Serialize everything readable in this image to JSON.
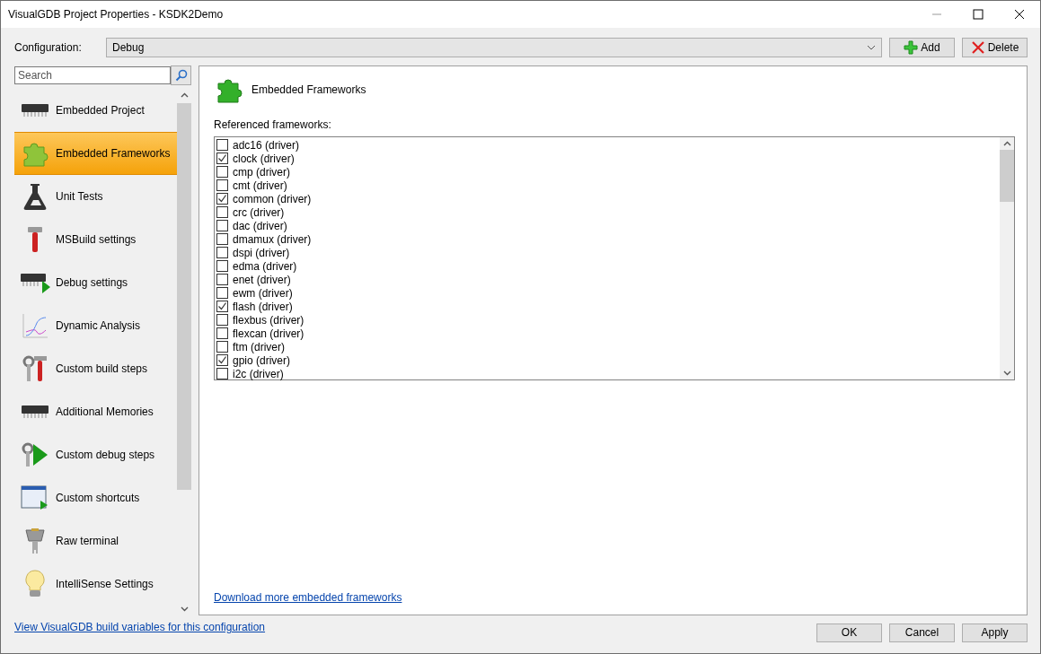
{
  "window": {
    "title": "VisualGDB Project Properties - KSDK2Demo"
  },
  "configuration": {
    "label": "Configuration:",
    "value": "Debug",
    "buttons": [
      {
        "kind": "add",
        "label": "Add"
      },
      {
        "kind": "delete",
        "label": "Delete"
      }
    ]
  },
  "search": {
    "placeholder": "Search"
  },
  "sidebar": {
    "items": [
      {
        "kind": "chip",
        "label": "Embedded Project",
        "selected": false
      },
      {
        "kind": "puzzle",
        "label": "Embedded Frameworks",
        "selected": true
      },
      {
        "kind": "flask",
        "label": "Unit Tests",
        "selected": false
      },
      {
        "kind": "hammer",
        "label": "MSBuild settings",
        "selected": false
      },
      {
        "kind": "chip-play",
        "label": "Debug settings",
        "selected": false
      },
      {
        "kind": "graph",
        "label": "Dynamic Analysis",
        "selected": false
      },
      {
        "kind": "tools",
        "label": "Custom build steps",
        "selected": false
      },
      {
        "kind": "chip",
        "label": "Additional Memories",
        "selected": false
      },
      {
        "kind": "wrench-play",
        "label": "Custom debug steps",
        "selected": false
      },
      {
        "kind": "window-play",
        "label": "Custom shortcuts",
        "selected": false
      },
      {
        "kind": "connector",
        "label": "Raw terminal",
        "selected": false
      },
      {
        "kind": "bulb",
        "label": "IntelliSense Settings",
        "selected": false
      }
    ]
  },
  "page": {
    "title": "Embedded Frameworks",
    "list_label": "Referenced frameworks:",
    "frameworks": [
      {
        "label": "adc16 (driver)",
        "checked": false
      },
      {
        "label": "clock (driver)",
        "checked": true
      },
      {
        "label": "cmp (driver)",
        "checked": false
      },
      {
        "label": "cmt (driver)",
        "checked": false
      },
      {
        "label": "common (driver)",
        "checked": true
      },
      {
        "label": "crc (driver)",
        "checked": false
      },
      {
        "label": "dac (driver)",
        "checked": false
      },
      {
        "label": "dmamux (driver)",
        "checked": false
      },
      {
        "label": "dspi (driver)",
        "checked": false
      },
      {
        "label": "edma (driver)",
        "checked": false
      },
      {
        "label": "enet (driver)",
        "checked": false
      },
      {
        "label": "ewm (driver)",
        "checked": false
      },
      {
        "label": "flash (driver)",
        "checked": true
      },
      {
        "label": "flexbus (driver)",
        "checked": false
      },
      {
        "label": "flexcan (driver)",
        "checked": false
      },
      {
        "label": "ftm (driver)",
        "checked": false
      },
      {
        "label": "gpio (driver)",
        "checked": true
      },
      {
        "label": "i2c (driver)",
        "checked": false
      }
    ],
    "link": "Download more embedded frameworks"
  },
  "footer": {
    "link": "View VisualGDB build variables for this configuration",
    "buttons": [
      "OK",
      "Cancel",
      "Apply"
    ]
  }
}
